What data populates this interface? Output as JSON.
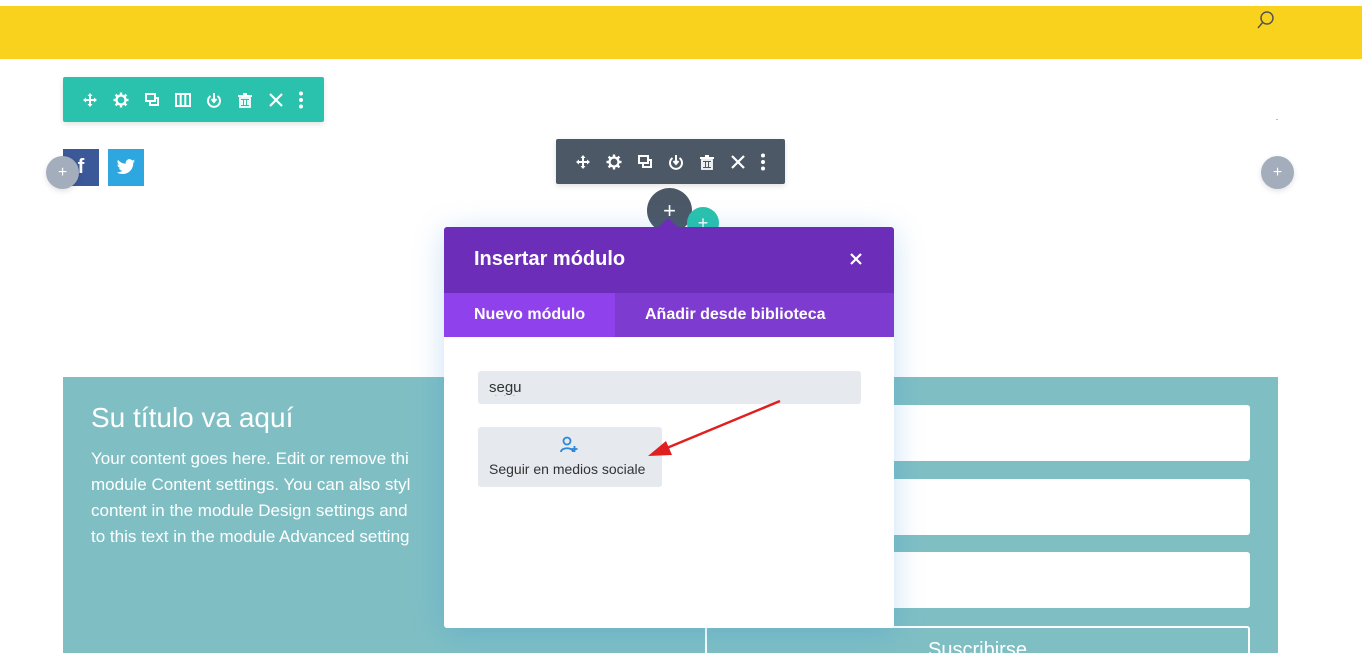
{
  "colors": {
    "header_bar": "#f8d21c",
    "row_toolbar": "#2bc2ad",
    "module_toolbar": "#4c5866",
    "modal_header": "#6c2eb9",
    "modal_tabs": "#7e3bd0",
    "active_tab": "#8f42ec",
    "teal_section": "#7fbfc4",
    "annotation_arrow": "#e02020"
  },
  "header": {
    "search_icon": "search-icon"
  },
  "row_toolbar": {
    "icons": [
      "move-icon",
      "settings-icon",
      "duplicate-icon",
      "columns-icon",
      "save-icon",
      "delete-icon",
      "close-icon",
      "more-icon"
    ]
  },
  "module_toolbar": {
    "icons": [
      "move-icon",
      "settings-icon",
      "duplicate-icon",
      "save-icon",
      "delete-icon",
      "close-icon",
      "more-icon"
    ]
  },
  "social": {
    "facebook_glyph": "f",
    "twitter_icon": "twitter-icon"
  },
  "plus_glyph": "+",
  "modal": {
    "title": "Insertar módulo",
    "tabs": [
      {
        "label": "Nuevo módulo",
        "active": true
      },
      {
        "label": "Añadir desde biblioteca",
        "active": false
      }
    ],
    "search_value": "segu",
    "results": [
      {
        "label": "Seguir en medios sociale",
        "icon": "user-add-icon"
      }
    ]
  },
  "section": {
    "title": "Su título va aquí",
    "body": "Your content goes here. Edit or remove thi\nmodule Content settings. You can also styl\ncontent in the module Design settings and\nto this text in the module Advanced setting",
    "subscribe_label": "Suscribirse"
  }
}
